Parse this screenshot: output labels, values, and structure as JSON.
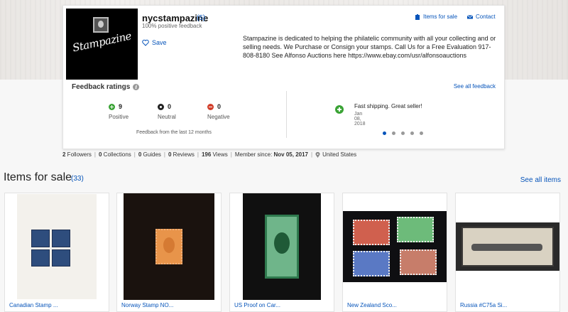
{
  "store": {
    "name": "nycstampazine",
    "feedback_count": "(5)",
    "positive_feedback": "100% positive feedback",
    "save_label": "Save",
    "logo_text": "Stampazine",
    "items_for_sale_link": "Items for sale",
    "contact_link": "Contact",
    "description": "Stampazine is dedicated to helping the philatelic community with all your collecting and or selling needs. We Purchase or Consign your stamps. Call Us for a Free Evaluation 917-808-8180 See Alfonso Auctions here https://www.ebay.com/usr/alfonsoauctions"
  },
  "feedback": {
    "title": "Feedback ratings",
    "see_all": "See all feedback",
    "positive": {
      "count": "9",
      "label": "Positive"
    },
    "neutral": {
      "count": "0",
      "label": "Neutral"
    },
    "negative": {
      "count": "0",
      "label": "Negative"
    },
    "period": "Feedback from the last 12 months",
    "comment": {
      "text": "Fast shipping. Great seller!",
      "date": "Jan 08, 2018"
    },
    "carousel": {
      "total": 5,
      "active": 0
    }
  },
  "stats": {
    "followers_num": "2",
    "followers_label": " Followers",
    "collections_num": "0",
    "collections_label": " Collections",
    "guides_num": "0",
    "guides_label": " Guides",
    "reviews_num": "0",
    "reviews_label": " Reviews",
    "views_num": "196",
    "views_label": " Views",
    "member_label": "Member since: ",
    "member_since": "Nov 05, 2017",
    "location": "United States"
  },
  "items_section": {
    "title": "Items for sale",
    "count": "(33)",
    "see_all": "See all items",
    "items": [
      {
        "caption": "Canadian Stamp ..."
      },
      {
        "caption": "Norway Stamp NO..."
      },
      {
        "caption": "US Proof on Car..."
      },
      {
        "caption": "New Zealand Sco..."
      },
      {
        "caption": "Russia #C75a Si..."
      }
    ]
  },
  "colors": {
    "link": "#0654ba",
    "positive": "#3aa335",
    "negative": "#d23f2b",
    "neutral": "#222222"
  },
  "icons": [
    "heart-icon",
    "store-icon",
    "mail-icon",
    "info-icon",
    "positive-icon",
    "neutral-icon",
    "negative-icon",
    "location-pin-icon"
  ]
}
